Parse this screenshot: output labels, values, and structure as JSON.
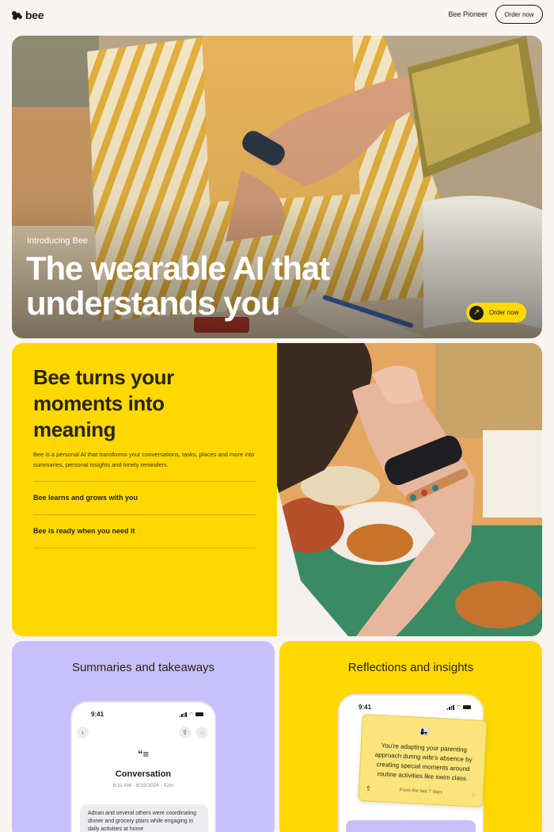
{
  "nav": {
    "brand": "bee",
    "link": "Bee Pioneer",
    "cta": "Order now"
  },
  "hero": {
    "eyebrow": "Introducing Bee",
    "title": "The wearable AI that understands you",
    "cta": "Order now",
    "cta_icon": "arrow-up-right-icon"
  },
  "feature": {
    "heading": "Bee turns your moments into meaning",
    "description": "Bee is a personal AI that transforms your conversations, tasks, places and more into summaries, personal insights and timely reminders.",
    "items": [
      "Bee learns and grows with you",
      "Bee is ready when you need it"
    ]
  },
  "cards": [
    {
      "title": "Summaries and takeaways",
      "phone": {
        "time": "9:41",
        "convo_title": "Conversation",
        "convo_meta": "8:11 AM - 8/15/2024 - 52m",
        "convo_text": "Adnan and several others were coordinating dinner and grocery plans while engaging in daily activities at home"
      }
    },
    {
      "title": "Reflections and insights",
      "phone": {
        "time": "9:41"
      },
      "note": {
        "emoji": "👩‍👧",
        "text": "You're adapting your parenting approach during wife's absence by creating special moments around routine activities like swim class.",
        "footer": "From the last 7 days"
      }
    }
  ],
  "colors": {
    "background": "#f7f4f1",
    "accent_yellow": "#ffd800",
    "accent_purple": "#c8c0fa",
    "text": "#1d1b16"
  }
}
